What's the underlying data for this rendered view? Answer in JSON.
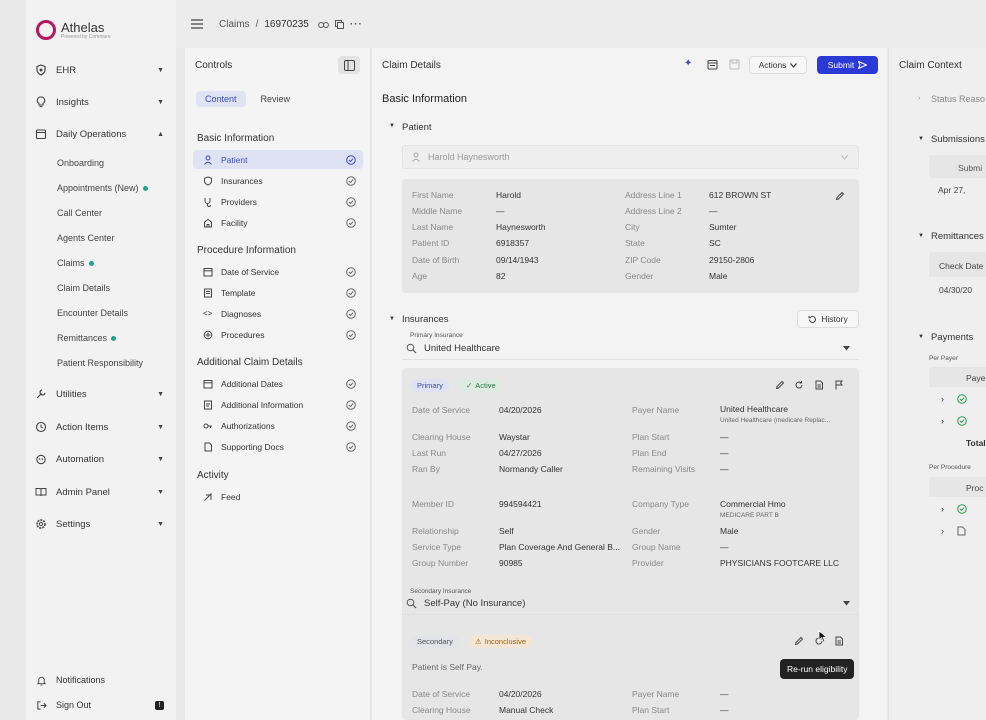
{
  "brand": {
    "name": "Athelas",
    "tagline": "Powered by Commure"
  },
  "sidebar": {
    "items": [
      {
        "label": "EHR",
        "icon": "shield-icon"
      },
      {
        "label": "Insights",
        "icon": "bulb-icon"
      },
      {
        "label": "Daily Operations",
        "icon": "calendar-icon"
      },
      {
        "label": "Utilities",
        "icon": "wrench-icon"
      },
      {
        "label": "Action Items",
        "icon": "clock-icon"
      },
      {
        "label": "Automation",
        "icon": "robot-icon"
      },
      {
        "label": "Admin Panel",
        "icon": "book-icon"
      },
      {
        "label": "Settings",
        "icon": "gear-icon"
      }
    ],
    "sub": [
      "Onboarding",
      "Appointments (New)",
      "Call Center",
      "Agents Center",
      "Claims",
      "Claim Details",
      "Encounter Details",
      "Remittances",
      "Patient Responsibility"
    ],
    "notifications": "Notifications",
    "signout": "Sign Out"
  },
  "topbar": {
    "section": "Claims",
    "sep": "/",
    "claim_id": "16970235"
  },
  "controls": {
    "title": "Controls",
    "tab_content": "Content",
    "tab_review": "Review",
    "sections": [
      {
        "title": "Basic Information",
        "items": [
          "Patient",
          "Insurances",
          "Providers",
          "Facility"
        ]
      },
      {
        "title": "Procedure Information",
        "items": [
          "Date of Service",
          "Template",
          "Diagnoses",
          "Procedures"
        ]
      },
      {
        "title": "Additional Claim Details",
        "items": [
          "Additional Dates",
          "Additional Information",
          "Authorizations",
          "Supporting Docs"
        ]
      },
      {
        "title": "Activity",
        "items": [
          "Feed"
        ]
      }
    ]
  },
  "details": {
    "title": "Claim Details",
    "actions": "Actions",
    "submit": "Submit",
    "basic_info": "Basic Information",
    "patient_section": "Patient",
    "patient_select": "Harold Haynesworth",
    "patient": {
      "first_name_label": "First Name",
      "first_name": "Harold",
      "middle_name_label": "Middle Name",
      "middle_name": "—",
      "last_name_label": "Last Name",
      "last_name": "Haynesworth",
      "patient_id_label": "Patient ID",
      "patient_id": "6918357",
      "dob_label": "Date of Birth",
      "dob": "09/14/1943",
      "age_label": "Age",
      "age": "82",
      "addr1_label": "Address Line 1",
      "addr1": "612 BROWN ST",
      "addr2_label": "Address Line 2",
      "addr2": "—",
      "city_label": "City",
      "city": "Sumter",
      "state_label": "State",
      "state": "SC",
      "zip_label": "ZIP Code",
      "zip": "29150-2806",
      "gender_label": "Gender",
      "gender": "Male"
    },
    "insurances_section": "Insurances",
    "history": "History",
    "primary_label": "Primary Insurance",
    "primary_value": "United Healthcare",
    "primary": {
      "tag1": "Primary",
      "tag2": "Active",
      "dos_label": "Date of Service",
      "dos": "04/20/2026",
      "clearing_label": "Clearing House",
      "clearing": "Waystar",
      "lastrun_label": "Last Run",
      "lastrun": "04/27/2026",
      "ranby_label": "Ran By",
      "ranby": "Normandy Caller",
      "payer_label": "Payer Name",
      "payer": "United Healthcare",
      "payer_sub": "United Healthcare (medicare Replac...",
      "planstart_label": "Plan Start",
      "planstart": "—",
      "planend_label": "Plan End",
      "planend": "—",
      "visits_label": "Remaining Visits",
      "visits": "—",
      "member_label": "Member ID",
      "member": "994594421",
      "relationship_label": "Relationship",
      "relationship": "Self",
      "service_label": "Service Type",
      "service": "Plan Coverage And General B...",
      "group_label": "Group Number",
      "group": "90985",
      "company_label": "Company Type",
      "company": "Commercial Hmo",
      "company_sub": "MEDICARE PART B",
      "gender_label": "Gender",
      "gender": "Male",
      "groupname_label": "Group Name",
      "groupname": "—",
      "provider_label": "Provider",
      "provider": "PHYSICIANS FOOTCARE LLC"
    },
    "secondary_label": "Secondary Insurance",
    "secondary_value": "Self-Pay (No Insurance)",
    "secondary": {
      "tag1": "Secondary",
      "tag2": "Inconclusive",
      "note": "Patient is Self Pay.",
      "dos_label": "Date of Service",
      "dos": "04/20/2026",
      "clearing_label": "Clearing House",
      "clearing": "Manual Check",
      "payer_label": "Payer Name",
      "payer": "—",
      "planstart_label": "Plan Start",
      "planstart": "—"
    },
    "tooltip": "Re-run eligibility"
  },
  "context": {
    "title": "Claim Context",
    "status": "Status Reaso",
    "submissions": "Submissions",
    "sub_col": "Submi",
    "sub_row": "Apr 27,",
    "remittances": "Remittances",
    "check_col": "Check Date",
    "check_row": "04/30/20",
    "payments": "Payments",
    "per_payer": "Per Payer",
    "payer_col": "Paye",
    "total": "Total",
    "per_procedure": "Per Procedure",
    "proc_col": "Proc"
  },
  "colors": {
    "accent": "#3b4bbf",
    "submit": "#2b39d6",
    "brand": "#b5175c",
    "green": "#1aa88a"
  }
}
